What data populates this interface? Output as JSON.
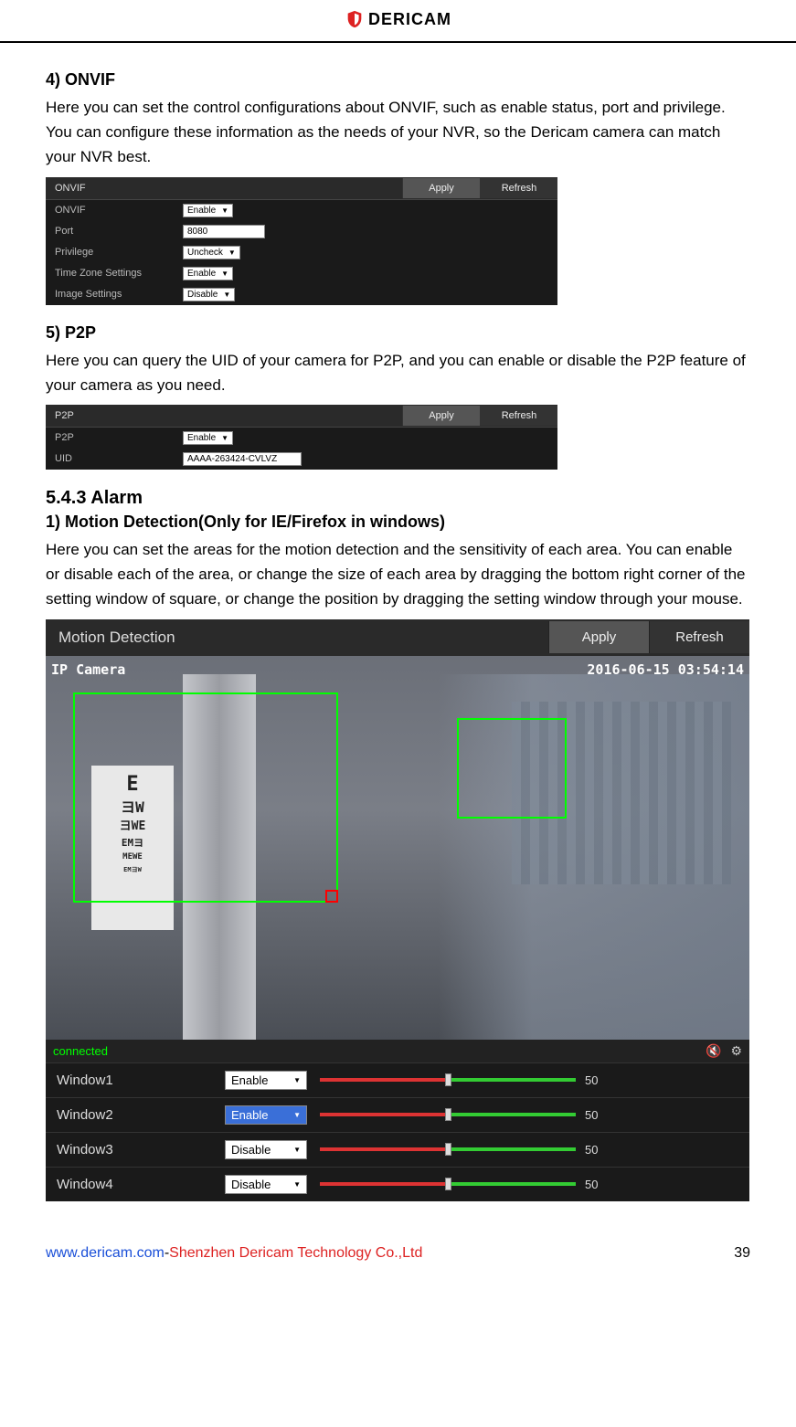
{
  "header": {
    "logo_text": "DERICAM"
  },
  "s4": {
    "title": "4) ONVIF",
    "body": "Here you can set the control configurations about ONVIF, such as enable status, port and privilege. You can configure these information as the needs of your NVR, so the Dericam camera can match your NVR best.",
    "panel_title": "ONVIF",
    "apply": "Apply",
    "refresh": "Refresh",
    "rows": {
      "onvif": {
        "label": "ONVIF",
        "value": "Enable"
      },
      "port": {
        "label": "Port",
        "value": "8080"
      },
      "privilege": {
        "label": "Privilege",
        "value": "Uncheck"
      },
      "tz": {
        "label": "Time Zone Settings",
        "value": "Enable"
      },
      "img": {
        "label": "Image Settings",
        "value": "Disable"
      }
    }
  },
  "s5": {
    "title": "5) P2P",
    "body": "Here you can query the UID of your camera for P2P, and you can enable or disable the P2P feature of your camera as you need.",
    "panel_title": "P2P",
    "apply": "Apply",
    "refresh": "Refresh",
    "rows": {
      "p2p": {
        "label": "P2P",
        "value": "Enable"
      },
      "uid": {
        "label": "UID",
        "value": "AAAA-263424-CVLVZ"
      }
    }
  },
  "alarm": {
    "heading": "5.4.3 Alarm",
    "sub_title": "1) Motion Detection(Only for IE/Firefox in windows)",
    "body": "Here you can set the areas for the motion detection and the sensitivity of each area. You can enable or disable each of the area, or change the size of each area by dragging the bottom right corner of the setting window of square, or change the position by dragging the setting window through your mouse.",
    "panel_title": "Motion Detection",
    "apply": "Apply",
    "refresh": "Refresh",
    "overlay_name": "IP Camera",
    "overlay_time": "2016-06-15 03:54:14",
    "eye_chart": [
      "E",
      "ヨW",
      "ヨWE",
      "EMヨ",
      "MEWE",
      "EMヨW"
    ],
    "status": "connected",
    "windows": [
      {
        "label": "Window1",
        "value": "Enable",
        "selected": false,
        "slider": 50
      },
      {
        "label": "Window2",
        "value": "Enable",
        "selected": true,
        "slider": 50
      },
      {
        "label": "Window3",
        "value": "Disable",
        "selected": false,
        "slider": 50
      },
      {
        "label": "Window4",
        "value": "Disable",
        "selected": false,
        "slider": 50
      }
    ]
  },
  "footer": {
    "url": "www.dericam.com",
    "sep": "-",
    "company": "Shenzhen Dericam Technology Co.,Ltd",
    "page": "39"
  }
}
